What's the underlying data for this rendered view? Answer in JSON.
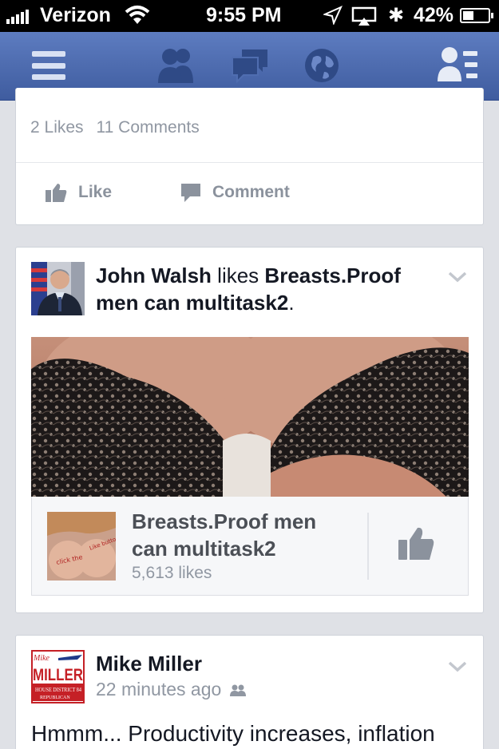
{
  "status_bar": {
    "carrier": "Verizon",
    "time": "9:55 PM",
    "battery": "42%",
    "battery_level": 0.42,
    "icons": [
      "signal-icon",
      "wifi-icon",
      "location-icon",
      "airplay-icon",
      "bluetooth-icon",
      "battery-icon"
    ]
  },
  "nav": {
    "icons": [
      "menu-icon",
      "friend-requests-icon",
      "messages-icon",
      "notifications-globe-icon",
      "contacts-icon"
    ],
    "bar_color": "#4b67a8"
  },
  "post1": {
    "likes": "2 Likes",
    "comments": "11 Comments",
    "like_label": "Like",
    "comment_label": "Comment"
  },
  "post2": {
    "actor": "John Walsh",
    "verb": "likes",
    "page_name": "Breasts.Proof men can multitask2",
    "punct": ".",
    "attachment": {
      "title": "Breasts.Proof men can multitask2",
      "likes": "5,613 likes",
      "thumb_text_left": "click the",
      "thumb_text_right": "Like button"
    }
  },
  "post3": {
    "author": "Mike Miller",
    "time": "22 minutes ago",
    "text": "Hmmm... Productivity increases, inflation",
    "logo": {
      "top": "Mike",
      "name": "MILLER",
      "district": "HOUSE DISTRICT 84",
      "party": "REPUBLICAN"
    }
  },
  "colors": {
    "accent": "#3b5998",
    "nav_top": "#5d7cc0",
    "nav_bottom": "#3f5c9f",
    "background": "#dfe1e6",
    "muted_text": "#9097a2"
  }
}
